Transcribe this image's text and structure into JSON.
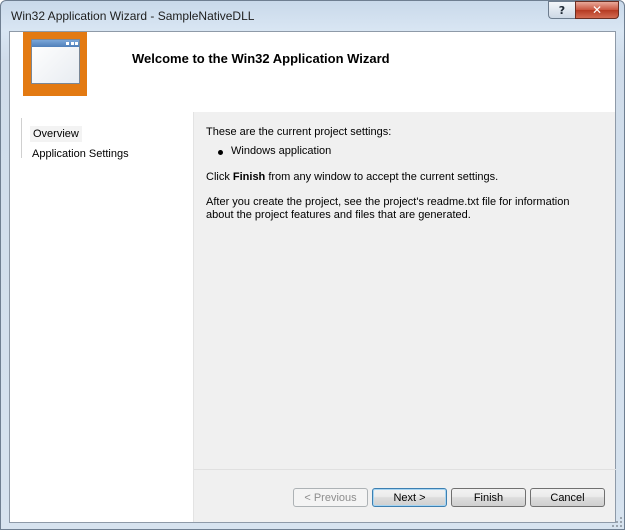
{
  "window": {
    "title": "Win32 Application Wizard - SampleNativeDLL",
    "help_glyph": "?",
    "close_glyph": "✕"
  },
  "header": {
    "title": "Welcome to the Win32 Application Wizard",
    "logo_icon": "wizard-window-icon",
    "logo_color": "#e37a12"
  },
  "nav": {
    "items": [
      {
        "label": "Overview",
        "active": true
      },
      {
        "label": "Application Settings",
        "active": false
      }
    ]
  },
  "content": {
    "settings_intro": "These are the current project settings:",
    "settings_items": [
      "Windows application"
    ],
    "finish_prefix": "Click ",
    "finish_bold": "Finish",
    "finish_suffix": " from any window to accept the current settings.",
    "readme_line1": "After you create the project, see the project's readme.txt file for information",
    "readme_line2": "about the project features and files that are generated."
  },
  "buttons": {
    "previous": "< Previous",
    "next": "Next >",
    "finish": "Finish",
    "cancel": "Cancel"
  }
}
